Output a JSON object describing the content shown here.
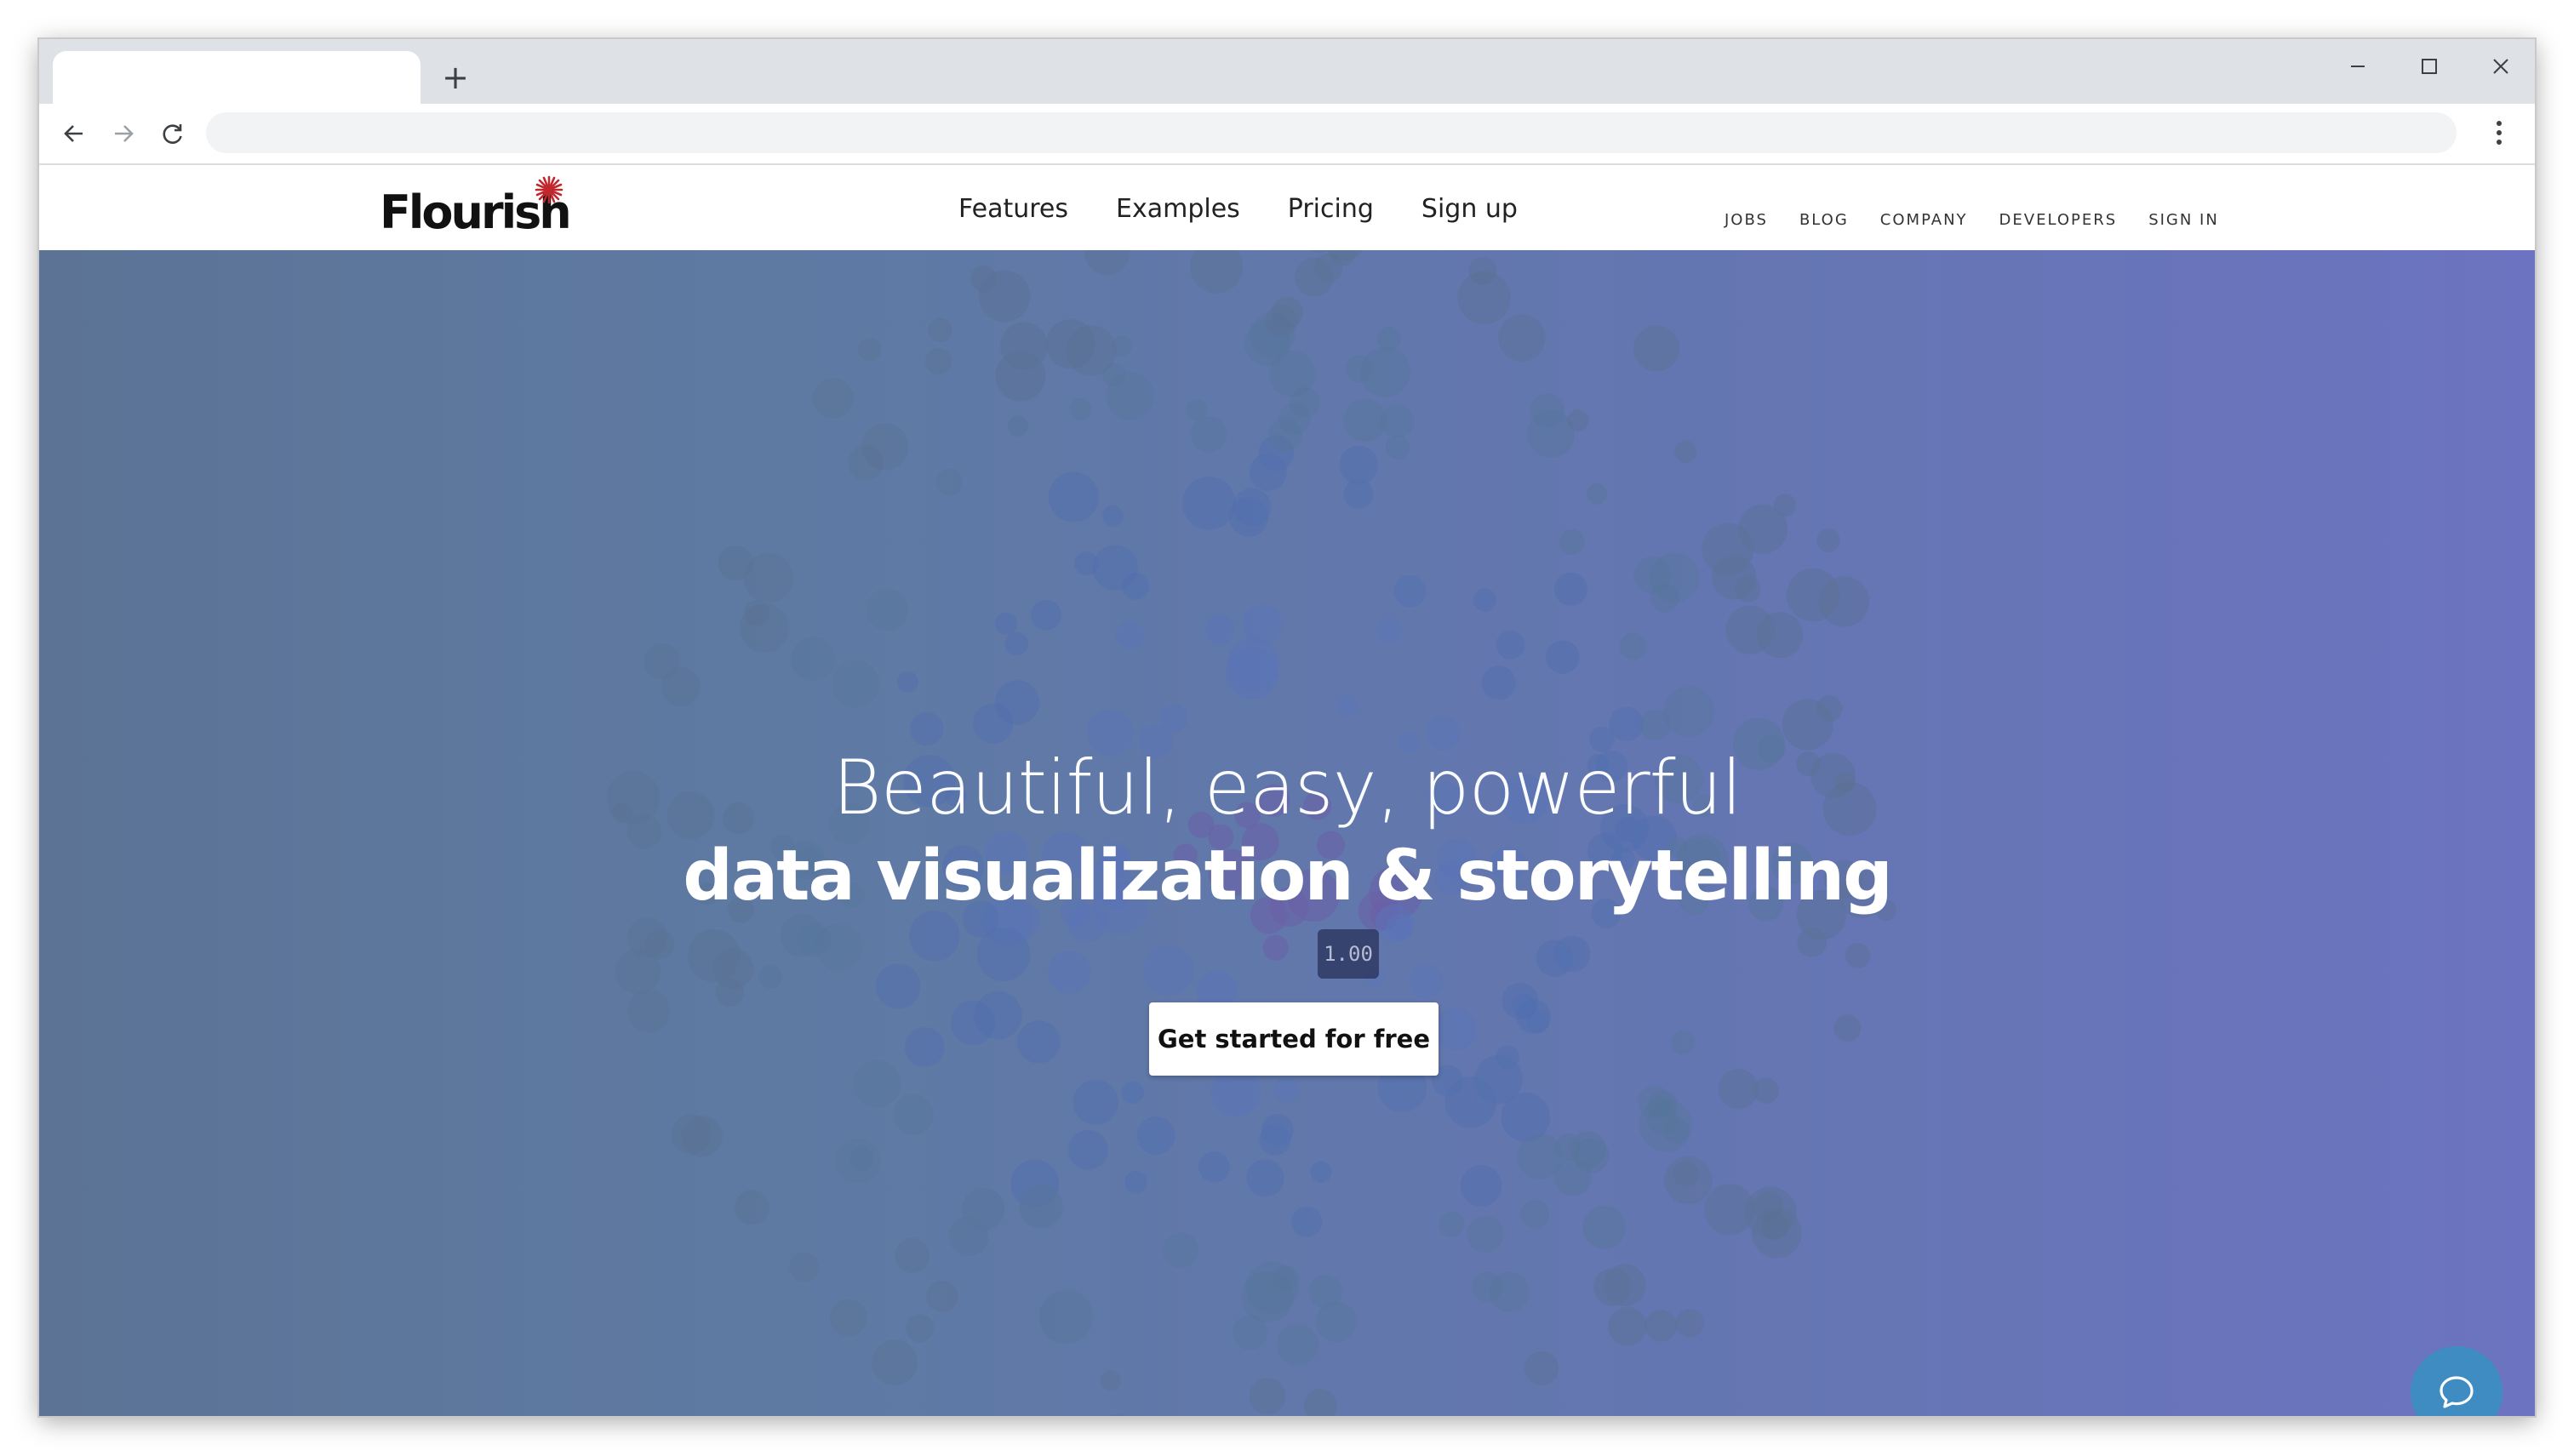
{
  "browser": {
    "active_tab_title": "",
    "new_tab_symbol": "+",
    "address": "",
    "window_controls": {
      "minimize": "—",
      "maximize": "☐",
      "close": "✕"
    }
  },
  "site": {
    "logo_text": "Flourish",
    "nav": [
      "Features",
      "Examples",
      "Pricing",
      "Sign up"
    ],
    "util_nav": [
      "JOBS",
      "BLOG",
      "COMPANY",
      "DEVELOPERS",
      "SIGN IN"
    ],
    "hero": {
      "line1": "Beautiful, easy, powerful",
      "line2": "data visualization & storytelling",
      "version_badge": "1.00",
      "cta_label": "Get started for free"
    }
  },
  "colors": {
    "hero_left": "#5c7395",
    "hero_right": "#6c73c0",
    "logo_star": "#c0282e",
    "chat": "#3f8cc2"
  },
  "icons": {
    "back": "arrow-left-icon",
    "forward": "arrow-right-icon",
    "reload": "reload-icon",
    "menu": "kebab-menu-icon",
    "chat": "chat-icon"
  }
}
